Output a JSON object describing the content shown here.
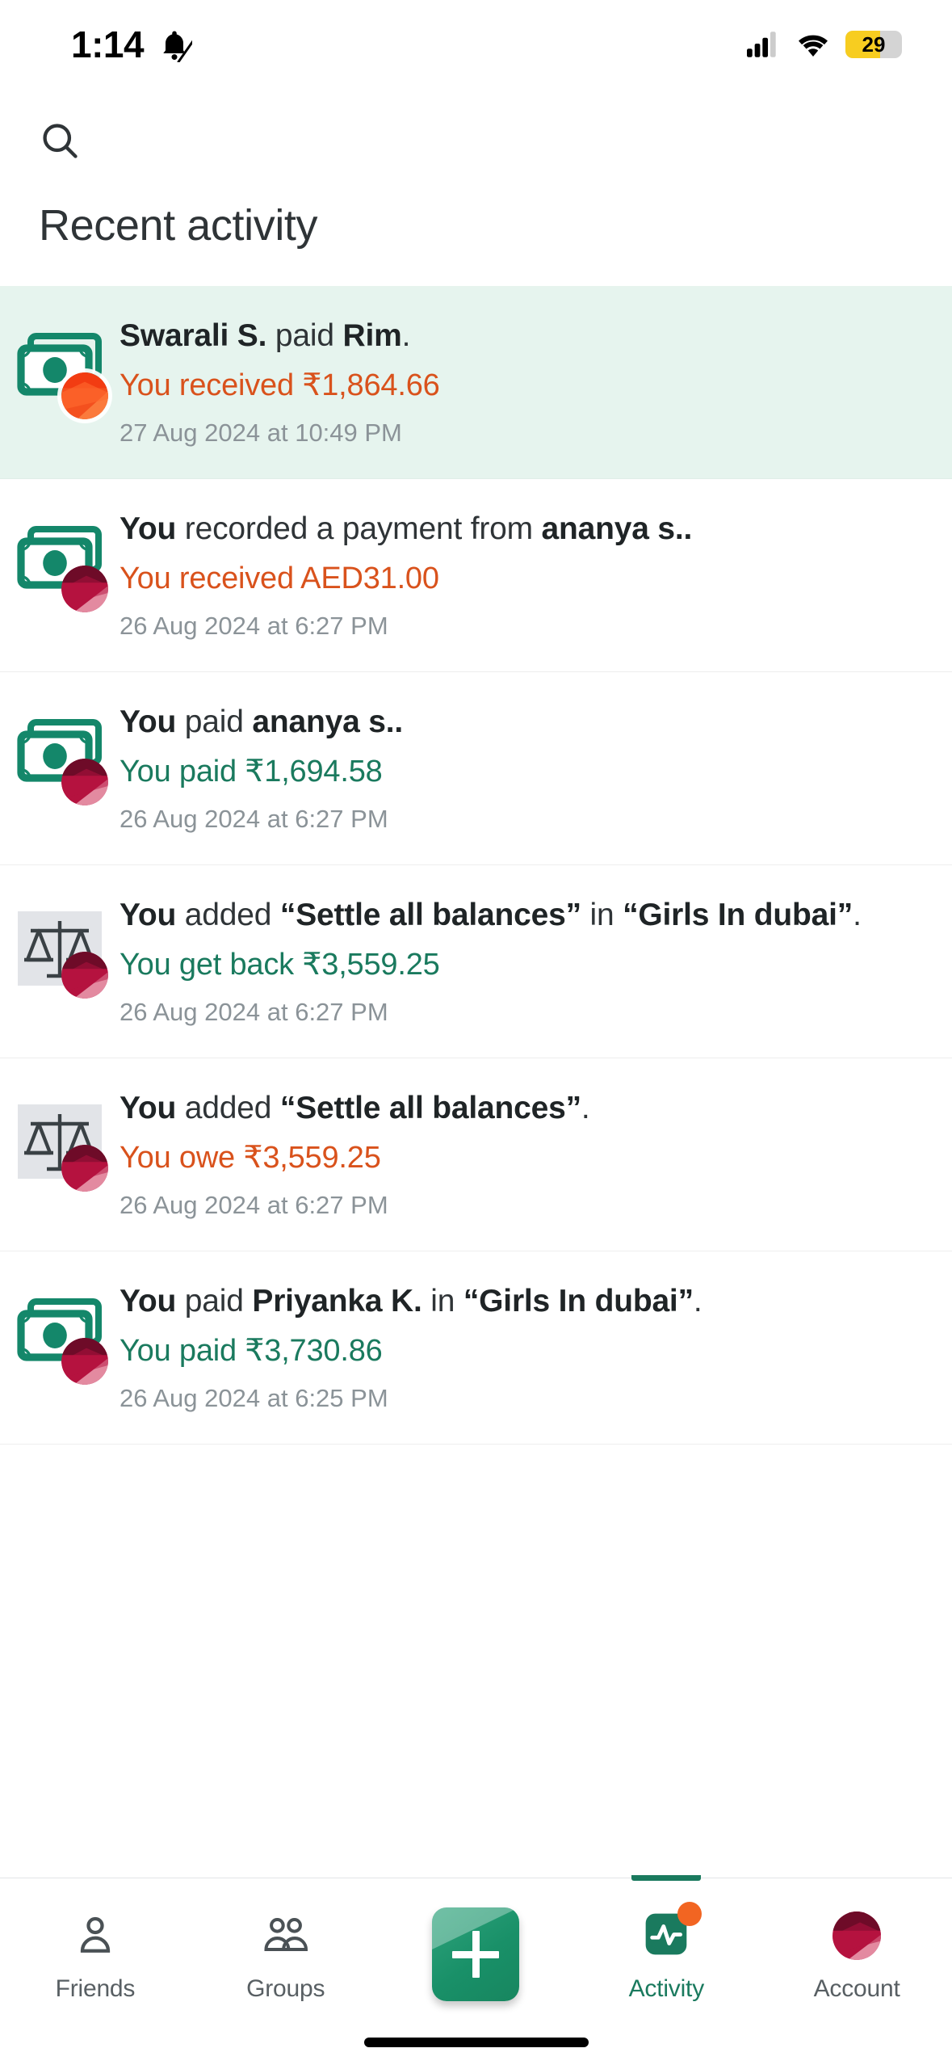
{
  "status_bar": {
    "time": "1:14",
    "silent_icon": "bell-slash-icon",
    "signal_icon": "cellular-signal-icon",
    "wifi_icon": "wifi-icon",
    "battery_percent": "29"
  },
  "header": {
    "search_icon": "search-icon",
    "title": "Recent activity"
  },
  "colors": {
    "owe_orange": "#d9521c",
    "paid_green": "#1a7a5e",
    "brand_teal": "#1a7a5e",
    "highlight_bg": "#e6f4ee",
    "avatar_crimson": "#b5123f",
    "avatar_orange": "#f4501e",
    "date_gray": "#8b9398"
  },
  "activity": [
    {
      "icon": "banknote-icon",
      "avatar": "avatar-orange",
      "highlighted": true,
      "main_parts": [
        {
          "text": "Swarali S.",
          "bold": true
        },
        {
          "text": " paid ",
          "bold": false
        },
        {
          "text": "Rim",
          "bold": true
        },
        {
          "text": ".",
          "bold": false
        }
      ],
      "amount_text": "You received ₹1,864.66",
      "amount_kind": "received",
      "date": "27 Aug 2024 at 10:49 PM"
    },
    {
      "icon": "banknote-icon",
      "avatar": "avatar-crimson",
      "highlighted": false,
      "main_parts": [
        {
          "text": "You",
          "bold": true
        },
        {
          "text": " recorded a payment from ",
          "bold": false
        },
        {
          "text": "ananya s..",
          "bold": true
        }
      ],
      "amount_text": "You received AED31.00",
      "amount_kind": "received",
      "date": "26 Aug 2024 at 6:27 PM"
    },
    {
      "icon": "banknote-icon",
      "avatar": "avatar-crimson",
      "highlighted": false,
      "main_parts": [
        {
          "text": "You",
          "bold": true
        },
        {
          "text": " paid ",
          "bold": false
        },
        {
          "text": "ananya s..",
          "bold": true
        }
      ],
      "amount_text": "You paid ₹1,694.58",
      "amount_kind": "paid",
      "date": "26 Aug 2024 at 6:27 PM"
    },
    {
      "icon": "scales-icon",
      "avatar": "avatar-crimson",
      "highlighted": false,
      "main_parts": [
        {
          "text": "You",
          "bold": true
        },
        {
          "text": " added ",
          "bold": false
        },
        {
          "text": "“Settle all balances”",
          "bold": true
        },
        {
          "text": " in ",
          "bold": false
        },
        {
          "text": "“Girls In dubai”",
          "bold": true
        },
        {
          "text": ".",
          "bold": false
        }
      ],
      "amount_text": "You get back ₹3,559.25",
      "amount_kind": "paid",
      "date": "26 Aug 2024 at 6:27 PM"
    },
    {
      "icon": "scales-icon",
      "avatar": "avatar-crimson",
      "highlighted": false,
      "main_parts": [
        {
          "text": "You",
          "bold": true
        },
        {
          "text": " added ",
          "bold": false
        },
        {
          "text": "“Settle all balances”",
          "bold": true
        },
        {
          "text": ".",
          "bold": false
        }
      ],
      "amount_text": "You owe ₹3,559.25",
      "amount_kind": "received",
      "date": "26 Aug 2024 at 6:27 PM"
    },
    {
      "icon": "banknote-icon",
      "avatar": "avatar-crimson",
      "highlighted": false,
      "main_parts": [
        {
          "text": "You",
          "bold": true
        },
        {
          "text": " paid ",
          "bold": false
        },
        {
          "text": "Priyanka K.",
          "bold": true
        },
        {
          "text": " in ",
          "bold": false
        },
        {
          "text": "“Girls In dubai”",
          "bold": true
        },
        {
          "text": ".",
          "bold": false
        }
      ],
      "amount_text": "You paid ₹3,730.86",
      "amount_kind": "paid",
      "date": "26 Aug 2024 at 6:25 PM"
    }
  ],
  "tabbar": {
    "tabs": [
      {
        "label": "Friends",
        "icon": "person-icon",
        "active": false
      },
      {
        "label": "Groups",
        "icon": "people-icon",
        "active": false
      },
      {
        "label": "",
        "icon": "add-expense-icon",
        "active": false
      },
      {
        "label": "Activity",
        "icon": "activity-pulse-icon",
        "active": true,
        "has_badge": true
      },
      {
        "label": "Account",
        "icon": "account-avatar-icon",
        "active": false
      }
    ]
  }
}
